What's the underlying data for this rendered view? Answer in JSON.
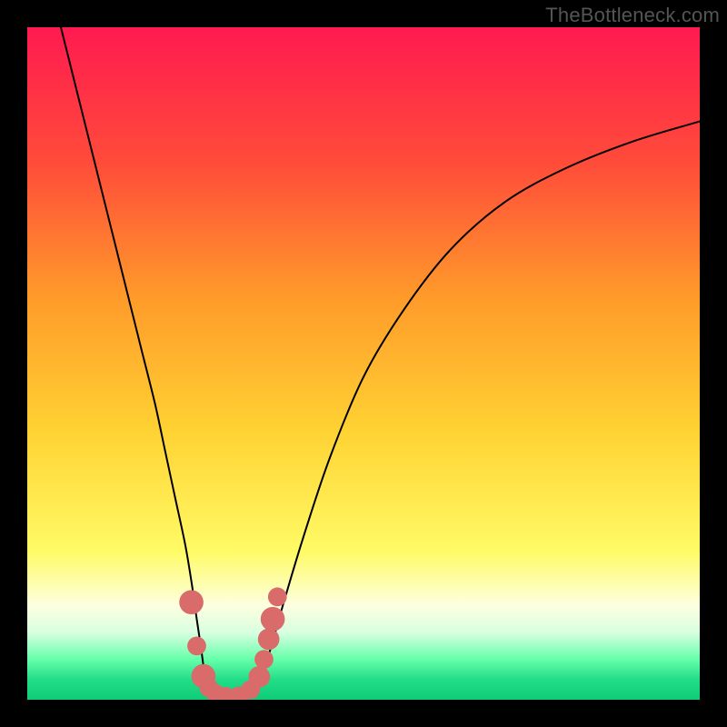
{
  "watermark": "TheBottleneck.com",
  "chart_data": {
    "type": "line",
    "title": "",
    "xlabel": "",
    "ylabel": "",
    "xlim": [
      0,
      100
    ],
    "ylim": [
      0,
      100
    ],
    "grid": false,
    "legend": false,
    "background_gradient_stops": [
      {
        "offset": 0.0,
        "color": "#ff1a50"
      },
      {
        "offset": 0.2,
        "color": "#ff4b3a"
      },
      {
        "offset": 0.4,
        "color": "#ff9a2a"
      },
      {
        "offset": 0.6,
        "color": "#ffd233"
      },
      {
        "offset": 0.78,
        "color": "#fffb66"
      },
      {
        "offset": 0.86,
        "color": "#fdffe0"
      },
      {
        "offset": 0.9,
        "color": "#d8ffe0"
      },
      {
        "offset": 0.94,
        "color": "#66ffaa"
      },
      {
        "offset": 0.97,
        "color": "#22dd88"
      },
      {
        "offset": 1.0,
        "color": "#11cc77"
      }
    ],
    "series": [
      {
        "name": "left-branch",
        "x": [
          5,
          7,
          9,
          11,
          13,
          15,
          17,
          19,
          20.5,
          22,
          23.5,
          24.5,
          25.2,
          25.8,
          26.2,
          26.5
        ],
        "y": [
          100,
          92,
          84,
          76,
          68,
          60,
          52,
          44,
          37,
          30,
          23,
          17,
          12,
          8,
          5,
          3
        ]
      },
      {
        "name": "valley-floor",
        "x": [
          26.5,
          27.5,
          29,
          31,
          33,
          34.5
        ],
        "y": [
          3,
          1.2,
          0.5,
          0.5,
          1.2,
          3
        ]
      },
      {
        "name": "right-branch",
        "x": [
          34.5,
          36,
          38,
          41,
          45,
          50,
          56,
          63,
          71,
          80,
          90,
          100
        ],
        "y": [
          3,
          7,
          14,
          24,
          36,
          48,
          58,
          67,
          74,
          79,
          83,
          86
        ]
      }
    ],
    "markers": {
      "name": "highlighted-points",
      "color": "#d96b6b",
      "points": [
        {
          "x": 24.4,
          "y": 14.5,
          "r": 1.8
        },
        {
          "x": 25.2,
          "y": 8.0,
          "r": 1.4
        },
        {
          "x": 26.2,
          "y": 3.5,
          "r": 1.8
        },
        {
          "x": 27.0,
          "y": 1.8,
          "r": 1.4
        },
        {
          "x": 28.0,
          "y": 0.9,
          "r": 1.4
        },
        {
          "x": 29.5,
          "y": 0.5,
          "r": 1.4
        },
        {
          "x": 31.5,
          "y": 0.6,
          "r": 1.4
        },
        {
          "x": 33.2,
          "y": 1.5,
          "r": 1.4
        },
        {
          "x": 34.5,
          "y": 3.4,
          "r": 1.6
        },
        {
          "x": 35.2,
          "y": 6.0,
          "r": 1.4
        },
        {
          "x": 35.9,
          "y": 9.0,
          "r": 1.6
        },
        {
          "x": 36.5,
          "y": 12.0,
          "r": 1.8
        },
        {
          "x": 37.2,
          "y": 15.3,
          "r": 1.4
        }
      ]
    }
  }
}
